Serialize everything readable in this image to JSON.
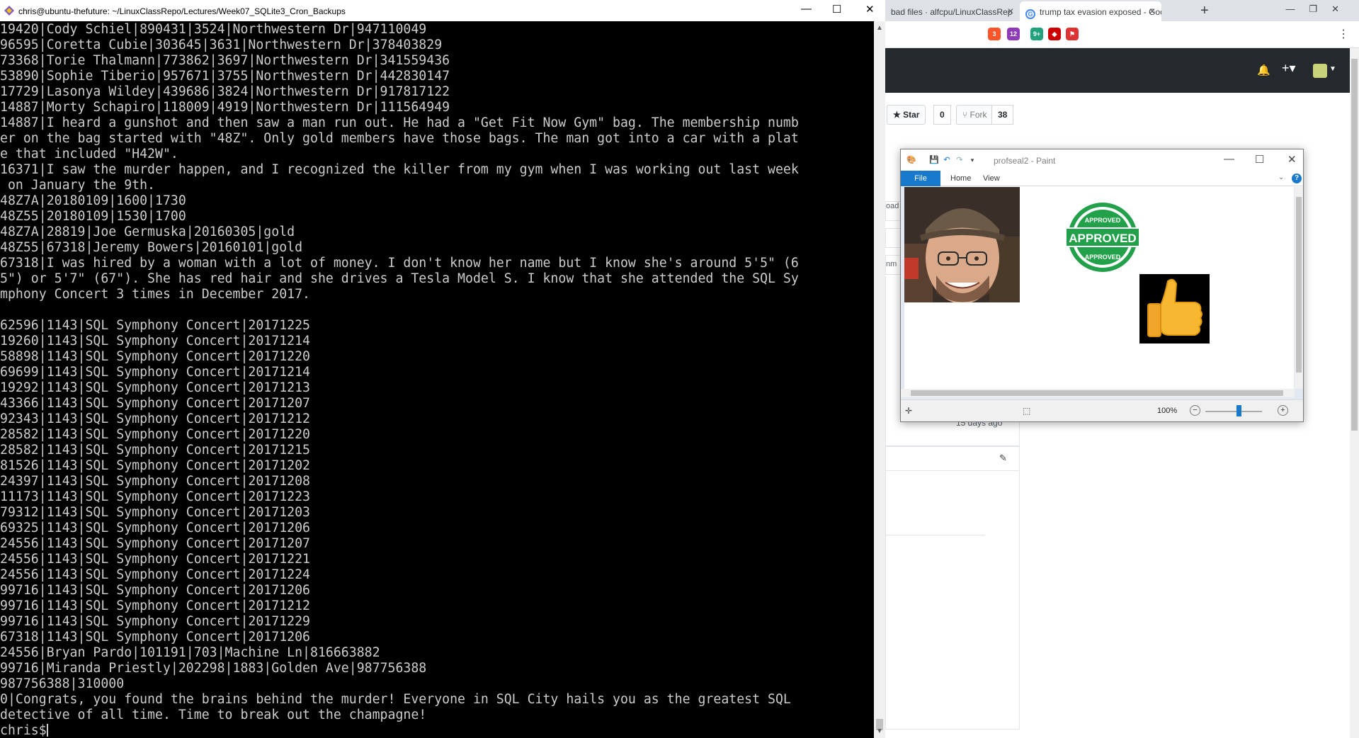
{
  "terminal": {
    "title": "chris@ubuntu-thefuture: ~/LinuxClassRepo/Lectures/Week07_SQLite3_Cron_Backups",
    "lines": [
      "19420|Cody Schiel|890431|3524|Northwestern Dr|947110049",
      "96595|Coretta Cubie|303645|3631|Northwestern Dr|378403829",
      "73368|Torie Thalmann|773862|3697|Northwestern Dr|341559436",
      "53890|Sophie Tiberio|957671|3755|Northwestern Dr|442830147",
      "17729|Lasonya Wildey|439686|3824|Northwestern Dr|917817122",
      "14887|Morty Schapiro|118009|4919|Northwestern Dr|111564949",
      "14887|I heard a gunshot and then saw a man run out. He had a \"Get Fit Now Gym\" bag. The membership numb",
      "er on the bag started with \"48Z\". Only gold members have those bags. The man got into a car with a plat",
      "e that included \"H42W\".",
      "16371|I saw the murder happen, and I recognized the killer from my gym when I was working out last week",
      " on January the 9th.",
      "48Z7A|20180109|1600|1730",
      "48Z55|20180109|1530|1700",
      "48Z7A|28819|Joe Germuska|20160305|gold",
      "48Z55|67318|Jeremy Bowers|20160101|gold",
      "67318|I was hired by a woman with a lot of money. I don't know her name but I know she's around 5'5\" (6",
      "5\") or 5'7\" (67\"). She has red hair and she drives a Tesla Model S. I know that she attended the SQL Sy",
      "mphony Concert 3 times in December 2017.",
      "",
      "62596|1143|SQL Symphony Concert|20171225",
      "19260|1143|SQL Symphony Concert|20171214",
      "58898|1143|SQL Symphony Concert|20171220",
      "69699|1143|SQL Symphony Concert|20171214",
      "19292|1143|SQL Symphony Concert|20171213",
      "43366|1143|SQL Symphony Concert|20171207",
      "92343|1143|SQL Symphony Concert|20171212",
      "28582|1143|SQL Symphony Concert|20171220",
      "28582|1143|SQL Symphony Concert|20171215",
      "81526|1143|SQL Symphony Concert|20171202",
      "24397|1143|SQL Symphony Concert|20171208",
      "11173|1143|SQL Symphony Concert|20171223",
      "79312|1143|SQL Symphony Concert|20171203",
      "69325|1143|SQL Symphony Concert|20171206",
      "24556|1143|SQL Symphony Concert|20171207",
      "24556|1143|SQL Symphony Concert|20171221",
      "24556|1143|SQL Symphony Concert|20171224",
      "99716|1143|SQL Symphony Concert|20171206",
      "99716|1143|SQL Symphony Concert|20171212",
      "99716|1143|SQL Symphony Concert|20171229",
      "67318|1143|SQL Symphony Concert|20171206",
      "24556|Bryan Pardo|101191|703|Machine Ln|816663882",
      "99716|Miranda Priestly|202298|1883|Golden Ave|987756388",
      "987756388|310000",
      "0|Congrats, you found the brains behind the murder! Everyone in SQL City hails you as the greatest SQL",
      "detective of all time. Time to break out the champagne!"
    ],
    "prompt": "chris$"
  },
  "browser": {
    "tabs": [
      {
        "label": "bad files · alfcpu/LinuxClassRep"
      },
      {
        "label": "trump tax evasion exposed - Goog"
      }
    ],
    "star_label": "Star",
    "star_count": "0",
    "fork_label": "Fork",
    "fork_count": "38",
    "fragment_upload": "oad",
    "fragment_time": "15 days ago",
    "fragment_nm": "nm",
    "ext_badges": [
      "3",
      "12",
      "9+"
    ]
  },
  "paint": {
    "title": "profseal2 - Paint",
    "tabs": {
      "file": "File",
      "home": "Home",
      "view": "View"
    },
    "help": "?",
    "zoom": "100%",
    "stamp_top": "APPROVED",
    "stamp_mid": "APPROVED",
    "stamp_bot": "APPROVED"
  },
  "colors": {
    "terminal_bg": "#000000",
    "terminal_fg": "#cccccc",
    "paint_accent": "#1979ca",
    "stamp_green": "#23a04a",
    "github_header": "#24292e"
  }
}
